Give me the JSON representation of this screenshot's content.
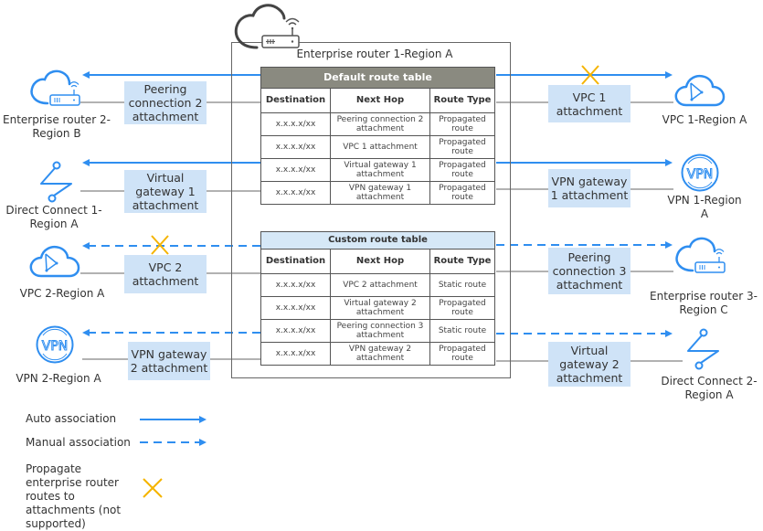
{
  "colors": {
    "accent": "#2f8ef0",
    "cross": "#f5b400",
    "table_header_default": "#8a8a80",
    "table_header_custom": "#d6e8f7",
    "attachment_fill": "#cfe3f7"
  },
  "center_router": {
    "label": "Enterprise router 1-Region A",
    "icon": "cloud-router-icon"
  },
  "default_table": {
    "title": "Default route table",
    "headers": [
      "Destination",
      "Next Hop",
      "Route Type"
    ],
    "rows": [
      [
        "x.x.x.x/xx",
        "Peering connection 2 attachment",
        "Propagated route"
      ],
      [
        "x.x.x.x/xx",
        "VPC 1 attachment",
        "Propagated route"
      ],
      [
        "x.x.x.x/xx",
        "Virtual gateway 1 attachment",
        "Propagated route"
      ],
      [
        "x.x.x.x/xx",
        "VPN gateway 1 attachment",
        "Propagated route"
      ]
    ]
  },
  "custom_table": {
    "title": "Custom route table",
    "headers": [
      "Destination",
      "Next Hop",
      "Route Type"
    ],
    "rows": [
      [
        "x.x.x.x/xx",
        "VPC 2 attachment",
        "Static route"
      ],
      [
        "x.x.x.x/xx",
        "Virtual gateway 2 attachment",
        "Propagated route"
      ],
      [
        "x.x.x.x/xx",
        "Peering connection 3 attachment",
        "Static route"
      ],
      [
        "x.x.x.x/xx",
        "VPN gateway 2 attachment",
        "Propagated route"
      ]
    ]
  },
  "left_nodes": [
    {
      "label": "Enterprise router 2-Region B",
      "icon": "cloud-router-icon",
      "attachment": "Peering connection 2 attachment",
      "association": "auto",
      "not_supported": false
    },
    {
      "label": "Direct Connect 1-Region A",
      "icon": "direct-connect-icon",
      "attachment": "Virtual gateway 1 attachment",
      "association": "auto",
      "not_supported": false
    },
    {
      "label": "VPC 2-Region A",
      "icon": "vpc-cloud-icon",
      "attachment": "VPC 2 attachment",
      "association": "manual",
      "not_supported": true
    },
    {
      "label": "VPN 2-Region A",
      "icon": "vpn-icon",
      "attachment": "VPN gateway 2 attachment",
      "association": "manual",
      "not_supported": false
    }
  ],
  "right_nodes": [
    {
      "label": "VPC 1-Region A",
      "icon": "vpc-cloud-icon",
      "attachment": "VPC 1 attachment",
      "association": "auto",
      "not_supported": true
    },
    {
      "label": "VPN 1-Region A",
      "icon": "vpn-icon",
      "attachment": "VPN gateway 1 attachment",
      "association": "auto",
      "not_supported": false
    },
    {
      "label": "Enterprise router 3-Region C",
      "icon": "cloud-router-icon",
      "attachment": "Peering connection 3 attachment",
      "association": "manual",
      "not_supported": false
    },
    {
      "label": "Direct Connect 2-Region A",
      "icon": "direct-connect-icon",
      "attachment": "Virtual gateway 2 attachment",
      "association": "manual",
      "not_supported": false
    }
  ],
  "legend": [
    {
      "label": "Auto association",
      "symbol": "solid-arrow"
    },
    {
      "label": "Manual association",
      "symbol": "dashed-arrow"
    },
    {
      "label": "Propagate enterprise router routes to attachments (not supported)",
      "symbol": "cross-icon"
    }
  ]
}
